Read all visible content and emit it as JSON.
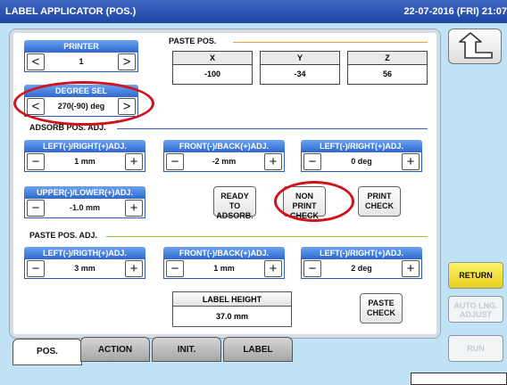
{
  "titlebar": {
    "title": "LABEL APPLICATOR (POS.)",
    "datetime": "22-07-2016 (FRI) 21:07"
  },
  "printer": {
    "label": "PRINTER",
    "value": "1"
  },
  "degree_sel": {
    "label": "DEGREE SEL",
    "value": "270(-90) deg"
  },
  "paste_pos": {
    "title": "PASTE POS.",
    "x": {
      "label": "X",
      "value": "-100"
    },
    "y": {
      "label": "Y",
      "value": "-34"
    },
    "z": {
      "label": "Z",
      "value": "56"
    }
  },
  "adsorb": {
    "title": "ADSORB POS. ADJ.",
    "lr": {
      "label": "LEFT(-)/RIGHT(+)ADJ.",
      "value": "1 mm"
    },
    "fb": {
      "label": "FRONT(-)/BACK(+)ADJ.",
      "value": "-2 mm"
    },
    "rot": {
      "label": "LEFT(-)/RIGHT(+)ADJ.",
      "value": "0 deg"
    },
    "ul": {
      "label": "UPPER(-)/LOWER(+)ADJ.",
      "value": "-1.0 mm"
    },
    "ready_button": {
      "line1": "READY TO",
      "line2": "ADSORB."
    },
    "nonprint_button": {
      "line1": "NON PRINT",
      "line2": "CHECK"
    },
    "print_button": {
      "line1": "PRINT",
      "line2": "CHECK"
    }
  },
  "paste_adj": {
    "title": "PASTE POS. ADJ.",
    "lr": {
      "label": "LEFT(-)/RIGTH(+)ADJ.",
      "value": "3 mm"
    },
    "fb": {
      "label": "FRONT(-)/BACK(+)ADJ.",
      "value": "1 mm"
    },
    "rot": {
      "label": "LEFT(-)/RIGHT(+)ADJ.",
      "value": "2 deg"
    },
    "label_height": {
      "label": "LABEL HEIGHT",
      "value": "37.0 mm"
    },
    "paste_check_button": {
      "line1": "PASTE",
      "line2": "CHECK"
    }
  },
  "tabs": [
    {
      "label": "POS.",
      "active": true
    },
    {
      "label": "ACTION",
      "active": false
    },
    {
      "label": "INIT.",
      "active": false
    },
    {
      "label": "LABEL",
      "active": false
    }
  ],
  "side": {
    "return_label": "RETURN",
    "auto_adjust_line1": "AUTO LNG.",
    "auto_adjust_line2": "ADJUST",
    "run_label": "RUN"
  },
  "symbols": {
    "left": "<",
    "right": ">",
    "minus": "−",
    "plus": "+"
  },
  "colors": {
    "titlebar": "#1f45a3",
    "header_blue": "#2f68cf",
    "highlight_red": "#d0121b",
    "return_yellow": "#f4e23a",
    "background": "#bfe3f4"
  }
}
